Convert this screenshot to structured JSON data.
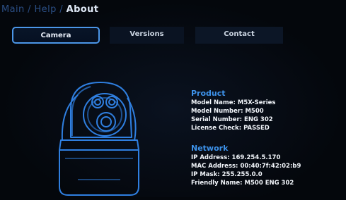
{
  "breadcrumb": {
    "main": "Main",
    "sep1": " / ",
    "help": "Help",
    "sep2": " / ",
    "about": "About"
  },
  "tabs": {
    "camera": "Camera",
    "versions": "Versions",
    "contact": "Contact"
  },
  "product": {
    "heading": "Product",
    "rows": [
      {
        "label": "Model Name:",
        "value": "M5X-Series"
      },
      {
        "label": "Model Number:",
        "value": "M500"
      },
      {
        "label": "Serial Number:",
        "value": "ENG 302"
      },
      {
        "label": "License Check:",
        "value": "PASSED"
      }
    ]
  },
  "network": {
    "heading": "Network",
    "rows": [
      {
        "label": "IP Address:",
        "value": "169.254.5.170"
      },
      {
        "label": "MAC Address:",
        "value": "00:40:7f:42:02:b9"
      },
      {
        "label": "IP Mask:",
        "value": "255.255.0.0"
      },
      {
        "label": "Friendly Name:",
        "value": "M500 ENG 302"
      }
    ]
  },
  "colors": {
    "accent": "#3d92ea",
    "breadcrumb_dim": "#2b4f86",
    "background": "#05080f"
  },
  "icons": {
    "camera_illustration": "camera-illustration-icon"
  }
}
